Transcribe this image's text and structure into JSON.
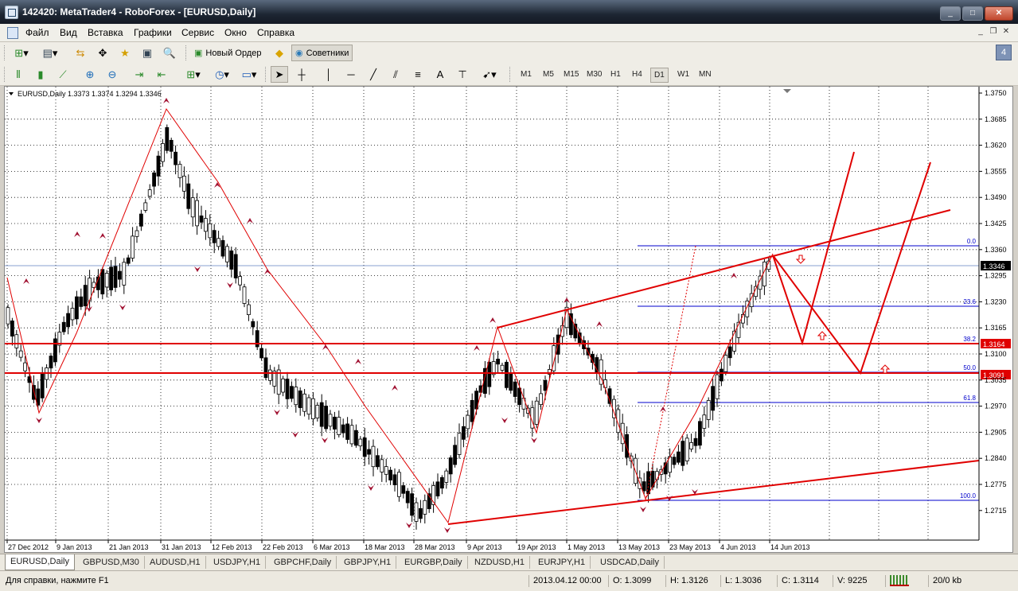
{
  "window": {
    "title": "142420: MetaTrader4 - RoboForex - [EURUSD,Daily]",
    "minimize_label": "_",
    "maximize_label": "□",
    "close_label": "✕"
  },
  "menu": {
    "items": [
      "Файл",
      "Вид",
      "Вставка",
      "Графики",
      "Сервис",
      "Окно",
      "Справка"
    ]
  },
  "toolbar1": {
    "new_order_label": "Новый Ордер",
    "experts_label": "Советники",
    "badge": "4"
  },
  "toolbar2": {
    "text_tool": "A",
    "timeframes": [
      "M1",
      "M5",
      "M15",
      "M30",
      "H1",
      "H4",
      "D1",
      "W1",
      "MN"
    ],
    "active_timeframe": "D1"
  },
  "chart": {
    "header": "EURUSD,Daily  1.3373 1.3374 1.3294 1.3346",
    "price_labels": [
      "1.3750",
      "1.3685",
      "1.3620",
      "1.3555",
      "1.3490",
      "1.3425",
      "1.3360",
      "1.3295",
      "1.3230",
      "1.3165",
      "1.3100",
      "1.3035",
      "1.2970",
      "1.2905",
      "1.2840",
      "1.2775",
      "1.2715"
    ],
    "date_labels": [
      "27 Dec 2012",
      "9 Jan 2013",
      "21 Jan 2013",
      "31 Jan 2013",
      "12 Feb 2013",
      "22 Feb 2013",
      "6 Mar 2013",
      "18 Mar 2013",
      "28 Mar 2013",
      "9 Apr 2013",
      "19 Apr 2013",
      "1 May 2013",
      "13 May 2013",
      "23 May 2013",
      "4 Jun 2013",
      "14 Jun 2013"
    ],
    "current_price_label": "1.3346",
    "hline_labels": [
      "1.3164",
      "1.3091"
    ],
    "fib_labels": [
      "0.0",
      "23.6",
      "38.2",
      "50.0",
      "61.8",
      "100.0"
    ],
    "colors": {
      "bull": "#ffffff",
      "bear": "#000000",
      "trend": "#e00000",
      "fib": "#0000cc",
      "grid": "#000000"
    }
  },
  "tabs": {
    "items": [
      "EURUSD,Daily",
      "GBPUSD,M30",
      "AUDUSD,H1",
      "USDJPY,H1",
      "GBPCHF,Daily",
      "GBPJPY,H1",
      "EURGBP,Daily",
      "NZDUSD,H1",
      "EURJPY,H1",
      "USDCAD,Daily"
    ],
    "active": "EURUSD,Daily"
  },
  "status": {
    "help": "Для справки, нажмите F1",
    "datetime": "2013.04.12 00:00",
    "open": "O: 1.3099",
    "high": "H: 1.3126",
    "low": "L: 1.3036",
    "close": "C: 1.3114",
    "volume": "V: 9225",
    "traffic": "20/0 kb"
  }
}
